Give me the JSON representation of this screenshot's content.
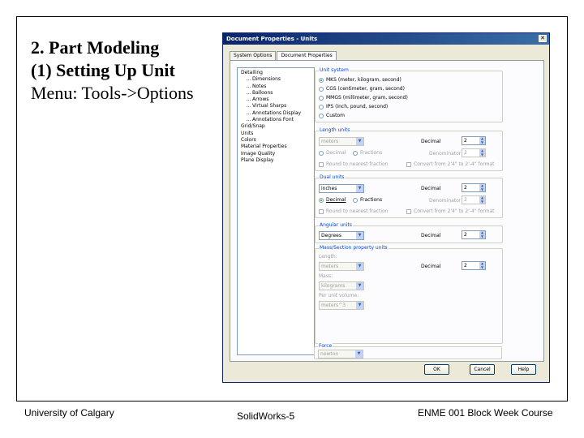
{
  "slide": {
    "title_line1": "2. Part Modeling",
    "title_line2": "(1) Setting Up Unit",
    "title_line3": "Menu: Tools->Options",
    "footer_left": "University of Calgary",
    "footer_center": "SolidWorks-5",
    "footer_right": "ENME 001 Block Week Course"
  },
  "dialog": {
    "title": "Document Properties - Units",
    "close_glyph": "✕",
    "tabs": [
      {
        "label": "System Options",
        "active": false
      },
      {
        "label": "Document Properties",
        "active": true
      }
    ],
    "tree": [
      {
        "label": "Detailing",
        "level": 1
      },
      {
        "label": "Dimensions",
        "level": 2
      },
      {
        "label": "Notes",
        "level": 2
      },
      {
        "label": "Balloons",
        "level": 2
      },
      {
        "label": "Arrows",
        "level": 2
      },
      {
        "label": "Virtual Sharps",
        "level": 2
      },
      {
        "label": "Annotations Display",
        "level": 2
      },
      {
        "label": "Annotations Font",
        "level": 2
      },
      {
        "label": "Grid/Snap",
        "level": 1
      },
      {
        "label": "Units",
        "level": 1
      },
      {
        "label": "Colors",
        "level": 1
      },
      {
        "label": "Material Properties",
        "level": 1
      },
      {
        "label": "Image Quality",
        "level": 1
      },
      {
        "label": "Plane Display",
        "level": 1
      }
    ],
    "unit_system": {
      "label": "Unit system",
      "options": [
        {
          "label": "MKS (meter, kilogram, second)",
          "checked": true
        },
        {
          "label": "CGS (centimeter, gram, second)",
          "checked": false
        },
        {
          "label": "MMGS (millimeter, gram, second)",
          "checked": false
        },
        {
          "label": "IPS (inch, pound, second)",
          "checked": false
        },
        {
          "label": "Custom",
          "checked": false
        }
      ]
    },
    "length_units": {
      "label": "Length units",
      "combo": "meters",
      "decimal_label": "Decimal",
      "decimal_value": "2",
      "radio_decimal": "Decimal",
      "radio_fractions": "Fractions",
      "denominator_label": "Denominator",
      "denominator_value": "2",
      "round_label": "Round to nearest fraction",
      "convert_label": "Convert from 2'4\" to 2'-4\" format"
    },
    "dual_units": {
      "label": "Dual units",
      "combo": "inches",
      "decimal_label": "Decimal",
      "decimal_value": "2",
      "radio_decimal": "Decimal",
      "radio_fractions": "Fractions",
      "denominator_label": "Denominator",
      "denominator_value": "2",
      "round_label": "Round to nearest fraction",
      "convert_label": "Convert from 2'4\" to 2'-4\" format"
    },
    "angular_units": {
      "label": "Angular units",
      "combo": "Degrees",
      "decimal_label": "Decimal",
      "decimal_value": "2"
    },
    "mass_section": {
      "label": "Mass/Section property units",
      "length_label": "Length:",
      "length_value": "meters",
      "decimal_label": "Decimal",
      "decimal_value": "2",
      "mass_label": "Mass:",
      "mass_value": "kilograms",
      "per_unit_volume_label": "Per unit volume:",
      "per_unit_volume_value": "meters^3"
    },
    "force": {
      "label": "Force",
      "value": "newton"
    },
    "buttons": {
      "ok": "OK",
      "cancel": "Cancel",
      "help": "Help"
    },
    "combo_arrow": "▼",
    "spin_up": "▲",
    "spin_down": "▼"
  }
}
